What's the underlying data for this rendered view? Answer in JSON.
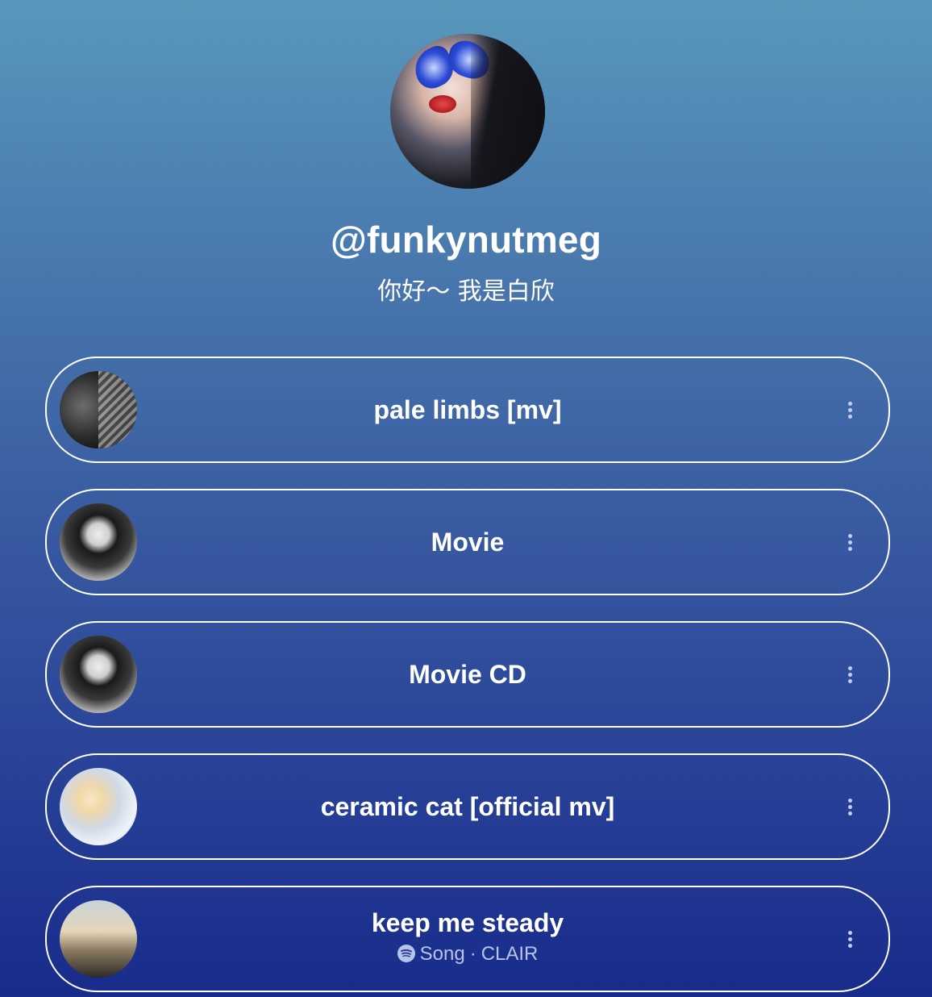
{
  "profile": {
    "avatar": "profile-photo",
    "username": "@funkynutmeg",
    "bio": "你好～ 我是白欣"
  },
  "links": [
    {
      "title": "pale limbs [mv]",
      "thumbnail": "black-and-white-photo"
    },
    {
      "title": "Movie",
      "thumbnail": "album-art"
    },
    {
      "title": "Movie CD",
      "thumbnail": "album-art"
    },
    {
      "title": "ceramic cat [official mv]",
      "thumbnail": "video-still"
    },
    {
      "title": "keep me steady",
      "thumbnail": "single-cover",
      "subtitle_type": "Song",
      "subtitle_separator": "·",
      "subtitle_artist": "CLAIR",
      "subtitle_icon": "spotify-icon"
    }
  ],
  "colors": {
    "gradient_top": "#5897bb",
    "gradient_bottom": "#182b8b",
    "text": "#ffffff",
    "subtitle": "#b8c3ea"
  }
}
